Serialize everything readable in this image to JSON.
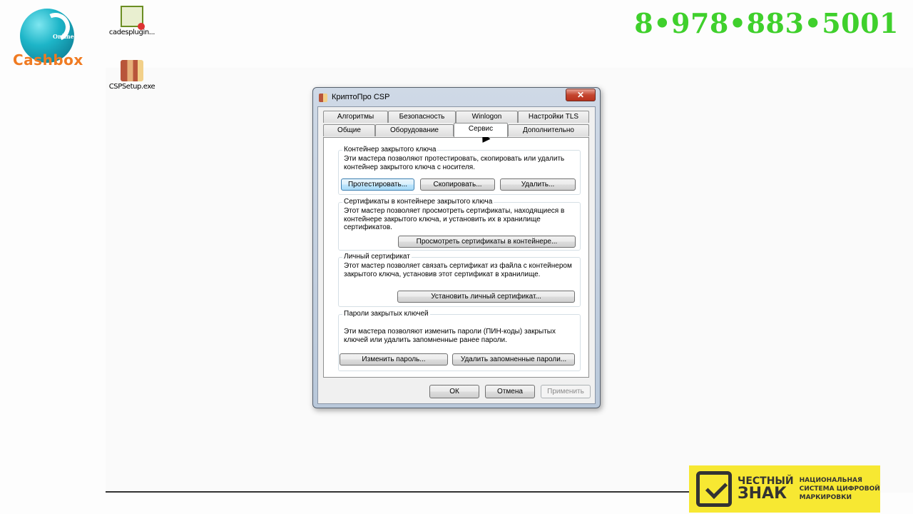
{
  "logo": {
    "brand": "Cashbox",
    "tagline": "Online"
  },
  "phone": "8•978•883•5001",
  "desktop_icons": [
    {
      "label": "cadesplugin..."
    },
    {
      "label": "CSPSetup.exe"
    }
  ],
  "banner": {
    "line1": "ЧЕСТНЫЙ",
    "line2": "ЗНАК",
    "sub1": "НАЦИОНАЛЬНАЯ",
    "sub2": "СИСТЕМА ЦИФРОВОЙ",
    "sub3": "МАРКИРОВКИ"
  },
  "window": {
    "title": "КриптоПро CSP",
    "close": "✕",
    "tabs_row1": [
      "Алгоритмы",
      "Безопасность",
      "Winlogon",
      "Настройки TLS"
    ],
    "tabs_row2": [
      "Общие",
      "Оборудование",
      "Сервис",
      "Дополнительно"
    ],
    "active_tab": "Сервис",
    "groups": {
      "container": {
        "title": "Контейнер закрытого ключа",
        "text": "Эти мастера позволяют протестировать, скопировать или удалить контейнер закрытого ключа с носителя.",
        "test": "Протестировать...",
        "copy": "Скопировать...",
        "delete": "Удалить..."
      },
      "certs": {
        "title": "Сертификаты в контейнере закрытого ключа",
        "text": "Этот мастер позволяет просмотреть сертификаты, находящиеся в контейнере закрытого ключа, и установить их в хранилище сертификатов.",
        "view": "Просмотреть сертификаты в контейнере..."
      },
      "personal": {
        "title": "Личный сертификат",
        "text": "Этот мастер позволяет связать сертификат из файла с контейнером закрытого ключа, установив этот сертификат в хранилище.",
        "install": "Установить личный сертификат..."
      },
      "passwords": {
        "title": "Пароли закрытых ключей",
        "text": "Эти мастера позволяют изменить пароли (ПИН-коды) закрытых ключей или удалить запомненные ранее пароли.",
        "change": "Изменить пароль...",
        "delete": "Удалить запомненные пароли..."
      }
    },
    "footer": {
      "ok": "ОК",
      "cancel": "Отмена",
      "apply": "Применить"
    }
  }
}
